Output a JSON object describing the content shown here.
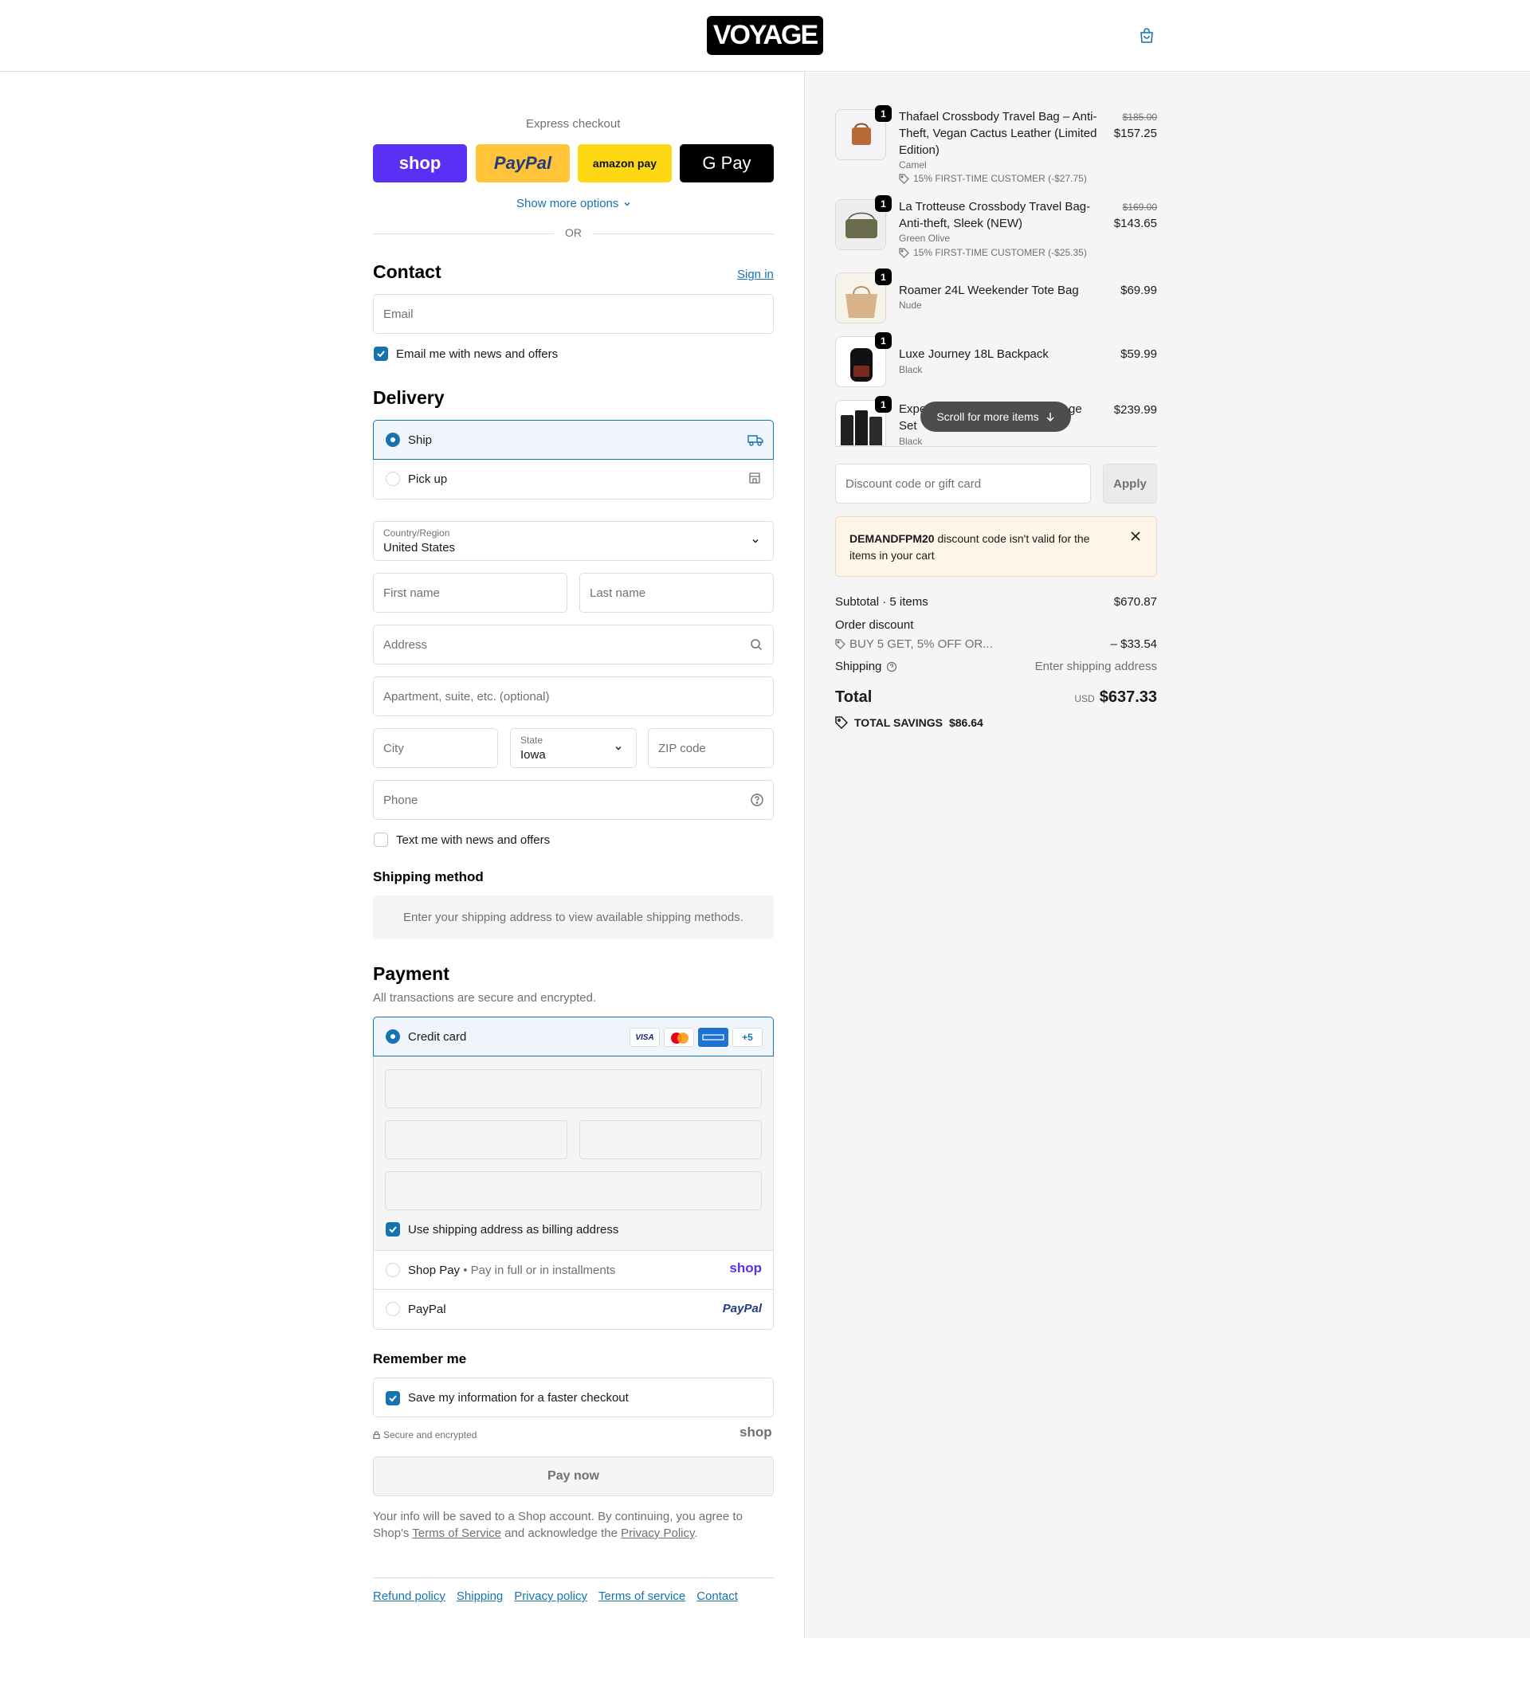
{
  "header": {
    "logo_text": "VOYAGE",
    "cart_icon": "shopping-bag-icon"
  },
  "express": {
    "title": "Express checkout",
    "buttons": [
      "shop",
      "PayPal",
      "amazon pay",
      "G Pay"
    ],
    "show_more": "Show more options",
    "or": "OR"
  },
  "contact": {
    "title": "Contact",
    "sign_in": "Sign in",
    "email_placeholder": "Email",
    "email_opt_in": "Email me with news and offers"
  },
  "delivery": {
    "title": "Delivery",
    "options": [
      "Ship",
      "Pick up"
    ],
    "country_label": "Country/Region",
    "country_value": "United States",
    "first_name": "First name",
    "last_name": "Last name",
    "address": "Address",
    "apartment": "Apartment, suite, etc. (optional)",
    "city": "City",
    "state_label": "State",
    "state_value": "Iowa",
    "zip": "ZIP code",
    "phone": "Phone",
    "text_opt_in": "Text me with news and offers"
  },
  "shipping_method": {
    "title": "Shipping method",
    "message": "Enter your shipping address to view available shipping methods."
  },
  "payment": {
    "title": "Payment",
    "subtitle": "All transactions are secure and encrypted.",
    "credit_card": "Credit card",
    "card_badges": [
      "VISA",
      "+5"
    ],
    "billing_same": "Use shipping address as billing address",
    "shop_pay": "Shop Pay",
    "shop_pay_sub": "Pay in full or in installments",
    "shop_logo": "shop",
    "paypal": "PayPal",
    "paypal_logo": "PayPal"
  },
  "remember": {
    "title": "Remember me",
    "save_info": "Save my information for a faster checkout",
    "secure": "Secure and encrypted",
    "shop_logo": "shop"
  },
  "pay_now": "Pay now",
  "legal": {
    "line1": "Your info will be saved to a Shop account. By continuing, you agree to",
    "line2_a": "Shop's ",
    "tos": "Terms of Service",
    "line2_b": " and acknowledge the ",
    "privacy": "Privacy Policy",
    "line2_c": "."
  },
  "footer": [
    "Refund policy",
    "Shipping",
    "Privacy policy",
    "Terms of service",
    "Contact"
  ],
  "cart": {
    "items": [
      {
        "qty": "1",
        "name_line1": "Thafael Crossbody Travel Bag – Anti-",
        "name_line2": "Theft, Vegan Cactus Leather (Limited",
        "name_line3": "Edition)",
        "variant": "Camel",
        "discount": "15% FIRST-TIME CUSTOMER (-$27.75)",
        "old_price": "$185.00",
        "price": "$157.25"
      },
      {
        "qty": "1",
        "name_line1": "La Trotteuse Crossbody Travel Bag-",
        "name_line2": "Anti-theft, Sleek (NEW)",
        "variant": "Green Olive",
        "discount": "15% FIRST-TIME CUSTOMER (-$25.35)",
        "old_price": "$169.00",
        "price": "$143.65"
      },
      {
        "qty": "1",
        "name_line1": "Roamer 24L Weekender Tote Bag",
        "variant": "Nude",
        "price": "$69.99"
      },
      {
        "qty": "1",
        "name_line1": "Luxe Journey 18L Backpack",
        "variant": "Black",
        "price": "$59.99"
      },
      {
        "qty": "1",
        "name_line1_a": "Expe",
        "name_line1_b": "ge",
        "name_line2": "Set",
        "variant": "Black",
        "price": "$239.99"
      }
    ],
    "scroll_hint": "Scroll for more items",
    "discount_placeholder": "Discount code or gift card",
    "apply": "Apply",
    "error_code": "DEMANDFPM20",
    "error_text": " discount code isn't valid for the",
    "error_text2": "items in your cart",
    "subtotal_label": "Subtotal · 5 items",
    "subtotal": "$670.87",
    "order_discount_label": "Order discount",
    "order_discount_code": "BUY 5 GET, 5% OFF OR...",
    "order_discount": "– $33.54",
    "shipping_label": "Shipping",
    "shipping_value": "Enter shipping address",
    "total_label": "Total",
    "currency": "USD",
    "total": "$637.33",
    "savings_label": "TOTAL SAVINGS",
    "savings": "$86.64"
  },
  "colors": {
    "accent": "#1773b0",
    "shop_purple": "#5a31f4",
    "paypal_yellow": "#ffc439",
    "amazon_yellow": "#ffd814"
  }
}
